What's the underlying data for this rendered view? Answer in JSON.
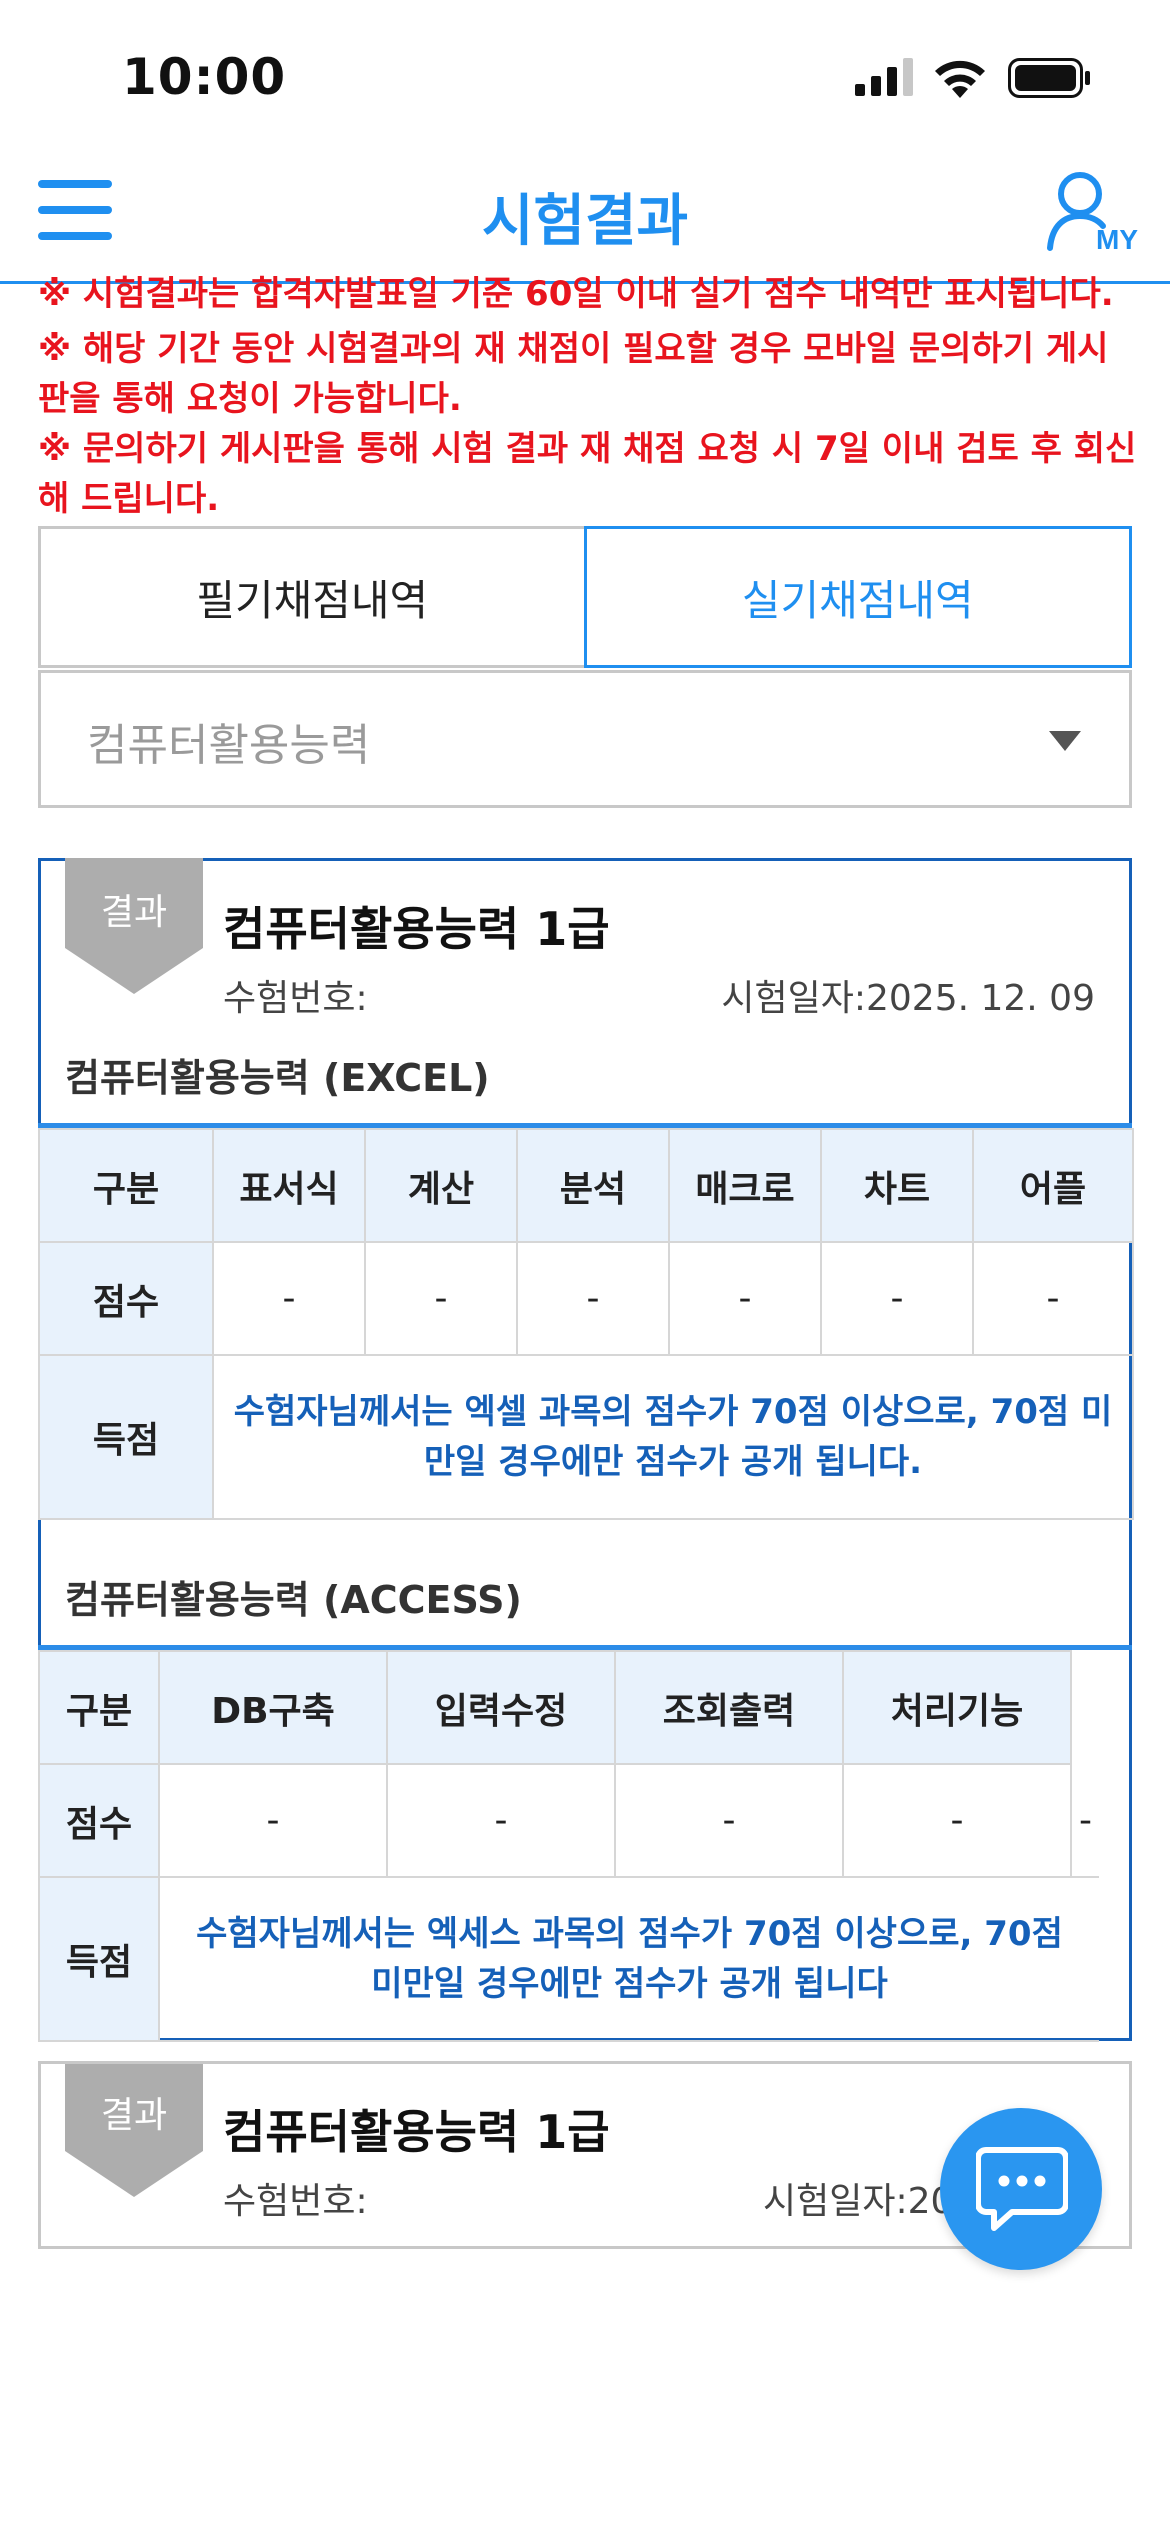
{
  "status_bar": {
    "time": "10:00"
  },
  "header": {
    "title": "시험결과"
  },
  "notices": [
    "※ 시험결과는 합격자발표일 기준 60일 이내 실기 점수 내역만 표시됩니다.",
    "※ 해당 기간 동안 시험결과의 재 채점이 필요할 경우 모바일 문의하기 게시판을 통해 요청이 가능합니다.",
    "※ 문의하기 게시판을 통해 시험 결과 재 채점 요청 시 7일 이내 검토 후 회신해 드립니다."
  ],
  "tabs": {
    "written": "필기채점내역",
    "practical": "실기채점내역",
    "active": "practical"
  },
  "select": {
    "value": "컴퓨터활용능력"
  },
  "cards": [
    {
      "badge": "결과",
      "title": "컴퓨터활용능력 1급",
      "exam_number_label": "수험번호:",
      "exam_date_label": "시험일자:",
      "exam_date": "2025. 12. 09",
      "excel": {
        "title": "컴퓨터활용능력 (EXCEL)",
        "headers": [
          "구분",
          "표서식",
          "계산",
          "분석",
          "매크로",
          "차트",
          "어플"
        ],
        "score_label": "점수",
        "scores": [
          "-",
          "-",
          "-",
          "-",
          "-",
          "-"
        ],
        "result_label": "득점",
        "result_notice": "수험자님께서는 엑셀 과목의 점수가 70점 이상으로, 70점 미만일 경우에만 점수가 공개 됩니다."
      },
      "access": {
        "title": "컴퓨터활용능력 (ACCESS)",
        "headers": [
          "구분",
          "DB구축",
          "입력수정",
          "조회출력",
          "처리기능"
        ],
        "score_label": "점수",
        "scores": [
          "-",
          "-",
          "-",
          "-",
          "-"
        ],
        "result_label": "득점",
        "result_notice": "수험자님께서는 엑세스 과목의 점수가 70점 이상으로, 70점 미만일 경우에만 점수가 공개 됩니다"
      }
    },
    {
      "badge": "결과",
      "title": "컴퓨터활용능력 1급",
      "exam_number_label": "수험번호:",
      "exam_date_label": "시험일자:",
      "exam_date_partial": "20"
    }
  ],
  "colors": {
    "accent": "#1f8ff0",
    "notice_red": "#e8141e",
    "notice_blue": "#1560b8"
  }
}
